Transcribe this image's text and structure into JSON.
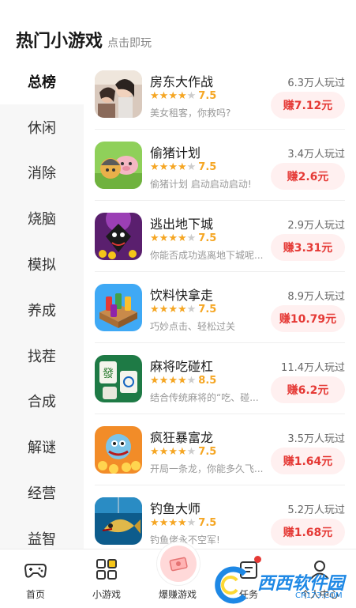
{
  "header": {
    "title": "热门小游戏",
    "subtitle": "点击即玩"
  },
  "sidebar": {
    "items": [
      {
        "label": "总榜"
      },
      {
        "label": "休闲"
      },
      {
        "label": "消除"
      },
      {
        "label": "烧脑"
      },
      {
        "label": "模拟"
      },
      {
        "label": "养成"
      },
      {
        "label": "找茬"
      },
      {
        "label": "合成"
      },
      {
        "label": "解谜"
      },
      {
        "label": "经营"
      },
      {
        "label": "益智"
      }
    ]
  },
  "games": [
    {
      "name": "房东大作战",
      "score": "7.5",
      "stars": 3.5,
      "desc": "美女租客，你救吗?",
      "plays": "6.3万人玩过",
      "reward": "赚7.12元"
    },
    {
      "name": "偷猪计划",
      "score": "7.5",
      "stars": 3.5,
      "desc": "偷猪计划 启动启动启动!",
      "plays": "3.4万人玩过",
      "reward": "赚2.6元"
    },
    {
      "name": "逃出地下城",
      "score": "7.5",
      "stars": 3.5,
      "desc": "你能否成功逃离地下城呢...",
      "plays": "2.9万人玩过",
      "reward": "赚3.31元"
    },
    {
      "name": "饮料快拿走",
      "score": "7.5",
      "stars": 3.5,
      "desc": "巧妙点击、轻松过关",
      "plays": "8.9万人玩过",
      "reward": "赚10.79元"
    },
    {
      "name": "麻将吃碰杠",
      "score": "8.5",
      "stars": 4,
      "desc": "结合传统麻将的“吃、碰...",
      "plays": "11.4万人玩过",
      "reward": "赚6.2元"
    },
    {
      "name": "疯狂暴富龙",
      "score": "7.5",
      "stars": 3.5,
      "desc": "开局一条龙，你能多久飞...",
      "plays": "3.5万人玩过",
      "reward": "赚1.64元"
    },
    {
      "name": "钓鱼大师",
      "score": "7.5",
      "stars": 3.5,
      "desc": "钓鱼佬永不空军!",
      "plays": "5.2万人玩过",
      "reward": "赚1.68元"
    }
  ],
  "tabbar": {
    "tabs": [
      {
        "label": "首页",
        "icon": "gamepad-icon"
      },
      {
        "label": "小游戏",
        "icon": "grid-icon"
      },
      {
        "label": "爆赚游戏",
        "icon": "money-icon"
      },
      {
        "label": "任务",
        "icon": "task-icon"
      },
      {
        "label": "个人中心",
        "icon": "user-icon"
      }
    ]
  },
  "watermark": {
    "text": "西西软件园",
    "sub": "CR173.COM"
  },
  "colors": {
    "accent_red": "#e53935",
    "star": "#f5a623",
    "reward_bg": "#fff0f0"
  }
}
